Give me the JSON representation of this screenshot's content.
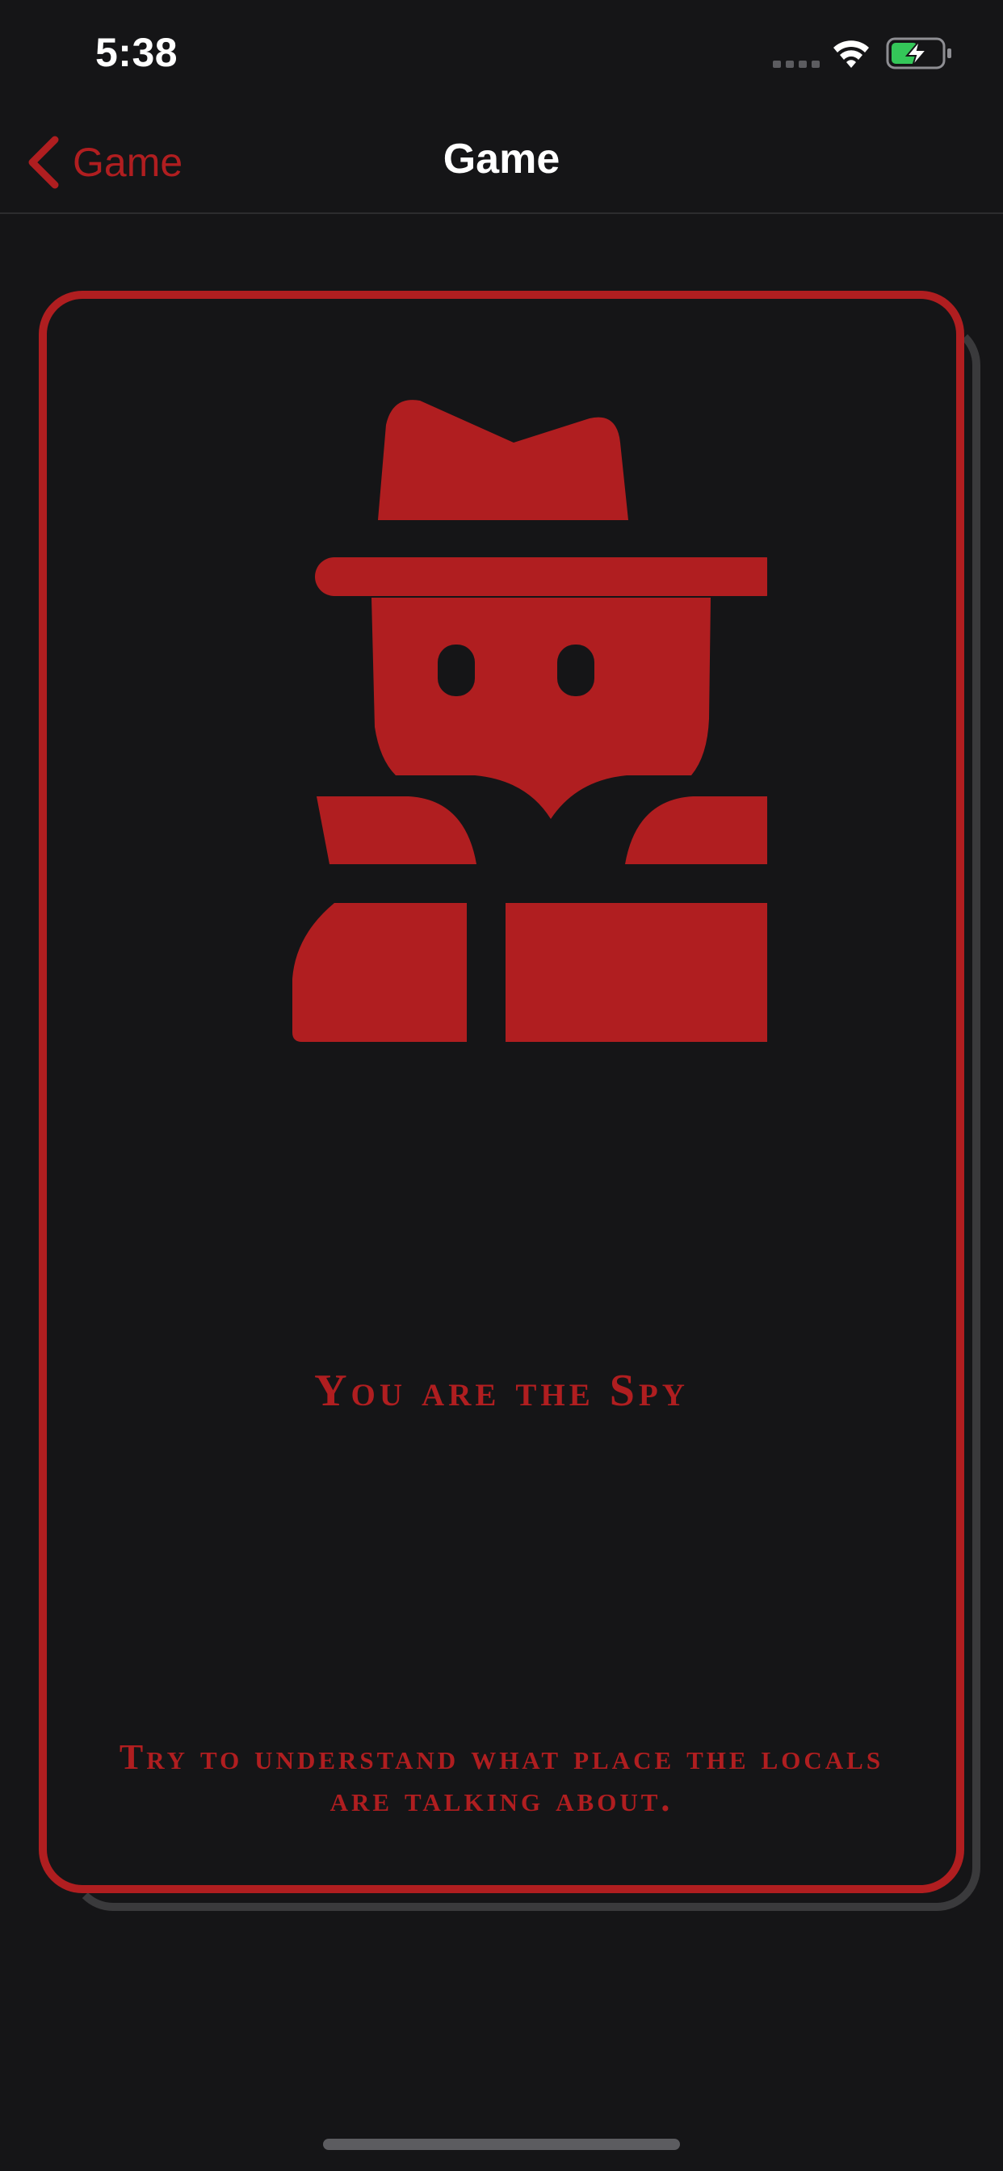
{
  "status_bar": {
    "time": "5:38",
    "icons": [
      "signal-icon",
      "wifi-icon",
      "battery-charging-icon"
    ]
  },
  "nav": {
    "back_label": "Game",
    "back_icon": "chevron-left-icon",
    "title": "Game"
  },
  "card": {
    "icon": "spy-icon",
    "title": "You are the Spy",
    "hint": "Try to understand what place the locals are talking about."
  },
  "colors": {
    "background": "#151517",
    "accent": "#b01e20",
    "card_shadow": "#3a3a3c",
    "battery_charge": "#34c759"
  }
}
